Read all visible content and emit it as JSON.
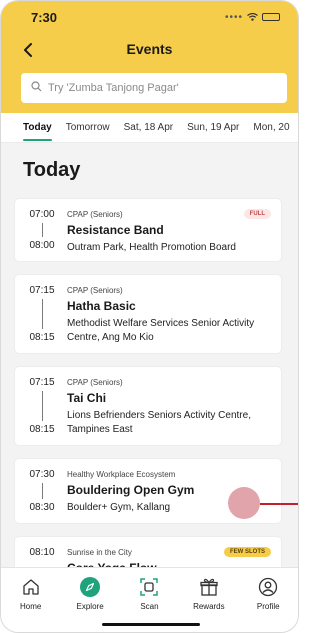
{
  "status_bar": {
    "time": "7:30",
    "signal": "••••"
  },
  "header": {
    "title": "Events",
    "back_glyph": "<"
  },
  "search": {
    "placeholder": "Try 'Zumba Tanjong Pagar'"
  },
  "tabs": [
    {
      "label": "Today",
      "active": true
    },
    {
      "label": "Tomorrow",
      "active": false
    },
    {
      "label": "Sat, 18 Apr",
      "active": false
    },
    {
      "label": "Sun, 19 Apr",
      "active": false
    },
    {
      "label": "Mon, 20",
      "active": false
    }
  ],
  "section": {
    "title": "Today"
  },
  "events": [
    {
      "start": "07:00",
      "end": "08:00",
      "category": "CPAP (Seniors)",
      "title": "Resistance Band",
      "venue": "Outram Park, Health Promotion Board",
      "badge": "FULL",
      "badge_type": "full"
    },
    {
      "start": "07:15",
      "end": "08:15",
      "category": "CPAP (Seniors)",
      "title": "Hatha Basic",
      "venue": "Methodist Welfare Services Senior Activity Centre, Ang Mo Kio",
      "badge": "",
      "badge_type": ""
    },
    {
      "start": "07:15",
      "end": "08:15",
      "category": "CPAP (Seniors)",
      "title": "Tai Chi",
      "venue": "Lions Befrienders Seniors Activity Centre, Tampines East",
      "badge": "",
      "badge_type": ""
    },
    {
      "start": "07:30",
      "end": "08:30",
      "category": "Healthy Workplace Ecosystem",
      "title": "Bouldering Open Gym",
      "venue": "Boulder+ Gym, Kallang",
      "badge": "",
      "badge_type": ""
    },
    {
      "start": "08:10",
      "end": "",
      "category": "Sunrise in the City",
      "title": "Core Yoga Flow",
      "venue": "",
      "badge": "FEW SLOTS",
      "badge_type": "few"
    }
  ],
  "bottom_nav": [
    {
      "label": "Home",
      "icon": "home-icon"
    },
    {
      "label": "Explore",
      "icon": "compass-icon"
    },
    {
      "label": "Scan",
      "icon": "scan-icon"
    },
    {
      "label": "Rewards",
      "icon": "gift-icon"
    },
    {
      "label": "Profile",
      "icon": "profile-icon"
    }
  ],
  "colors": {
    "header": "#f6cd4a",
    "accent": "#1fa37a",
    "full_badge": "#fde6e6",
    "few_badge": "#f6cd4a"
  }
}
